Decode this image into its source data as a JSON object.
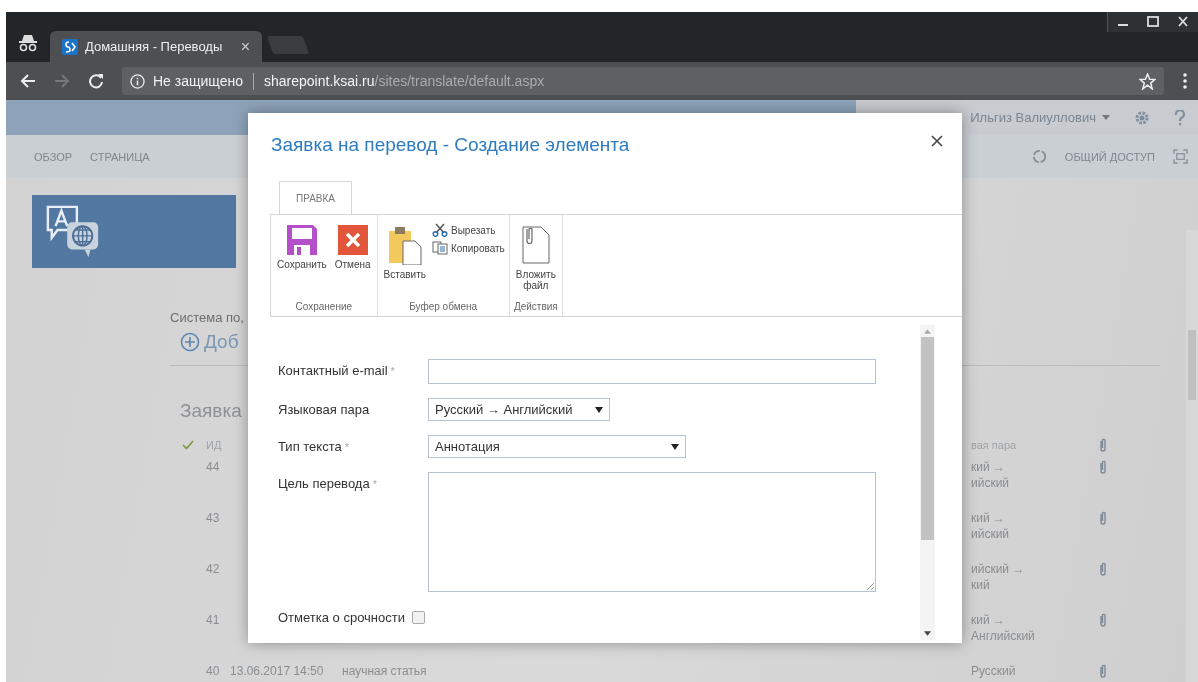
{
  "browser": {
    "tab_title": "Домашняя - Переводы",
    "tab_close": "×",
    "security": "Не защищено",
    "url_host": "sharepoint.ksai.ru",
    "url_path": "/sites/translate/default.aspx"
  },
  "suite_bar": {
    "user": "Ильгиз Валиуллович"
  },
  "page_nav": {
    "tabs": [
      "ОБЗОР",
      "СТРАНИЦА"
    ],
    "share": "ОБЩИЙ ДОСТУП"
  },
  "page": {
    "description": "Система по,",
    "new_item": "Доб",
    "list_title": "Заявка",
    "columns": {
      "id": "ИД",
      "pair": "вая пара"
    },
    "rows": [
      {
        "id": "44",
        "date": "",
        "type": "",
        "pair": [
          "кий →",
          "ийский"
        ],
        "attachment": true
      },
      {
        "id": "43",
        "date": "",
        "type": "",
        "pair": [
          "кий →",
          "ийский"
        ],
        "attachment": true
      },
      {
        "id": "42",
        "date": "",
        "type": "",
        "pair": [
          "ийский →",
          "кий"
        ],
        "attachment": true
      },
      {
        "id": "41",
        "date": "",
        "type": "",
        "pair": [
          "кий →",
          "Английский"
        ],
        "attachment": true
      },
      {
        "id": "40",
        "date": "13.06.2017 14:50",
        "type": "научная статья",
        "pair": [
          "Русский"
        ],
        "attachment": true
      }
    ]
  },
  "dialog": {
    "title": "Заявка на перевод - Создание элемента",
    "ribbon_tabs": [
      {
        "label": "ПРАВКА",
        "selected": true
      }
    ],
    "ribbon_groups": [
      {
        "label": "Сохранение",
        "buttons": [
          {
            "kind": "save",
            "label": "Сохранить"
          },
          {
            "kind": "cancel",
            "label": "Отмена"
          }
        ]
      },
      {
        "label": "Буфер обмена",
        "buttons": [
          {
            "kind": "paste",
            "label": "Вставить"
          },
          {
            "kind": "cut",
            "label": "Вырезать"
          },
          {
            "kind": "copy",
            "label": "Копировать"
          }
        ]
      },
      {
        "label": "Действия",
        "buttons": [
          {
            "kind": "attach",
            "label": "Вложить файл"
          }
        ]
      }
    ],
    "fields": [
      {
        "kind": "text",
        "label": "Контактный e-mail",
        "required_mark": "*"
      },
      {
        "kind": "select",
        "label": "Языковая пара",
        "value": "Русский → Английский"
      },
      {
        "kind": "select",
        "label": "Тип текста",
        "required_mark": "*",
        "value": "Аннотация"
      },
      {
        "kind": "textarea",
        "label": "Цель перевода",
        "required_mark": "*"
      },
      {
        "kind": "checkbox",
        "label": "Отметка о срочности",
        "checked": false
      }
    ]
  }
}
